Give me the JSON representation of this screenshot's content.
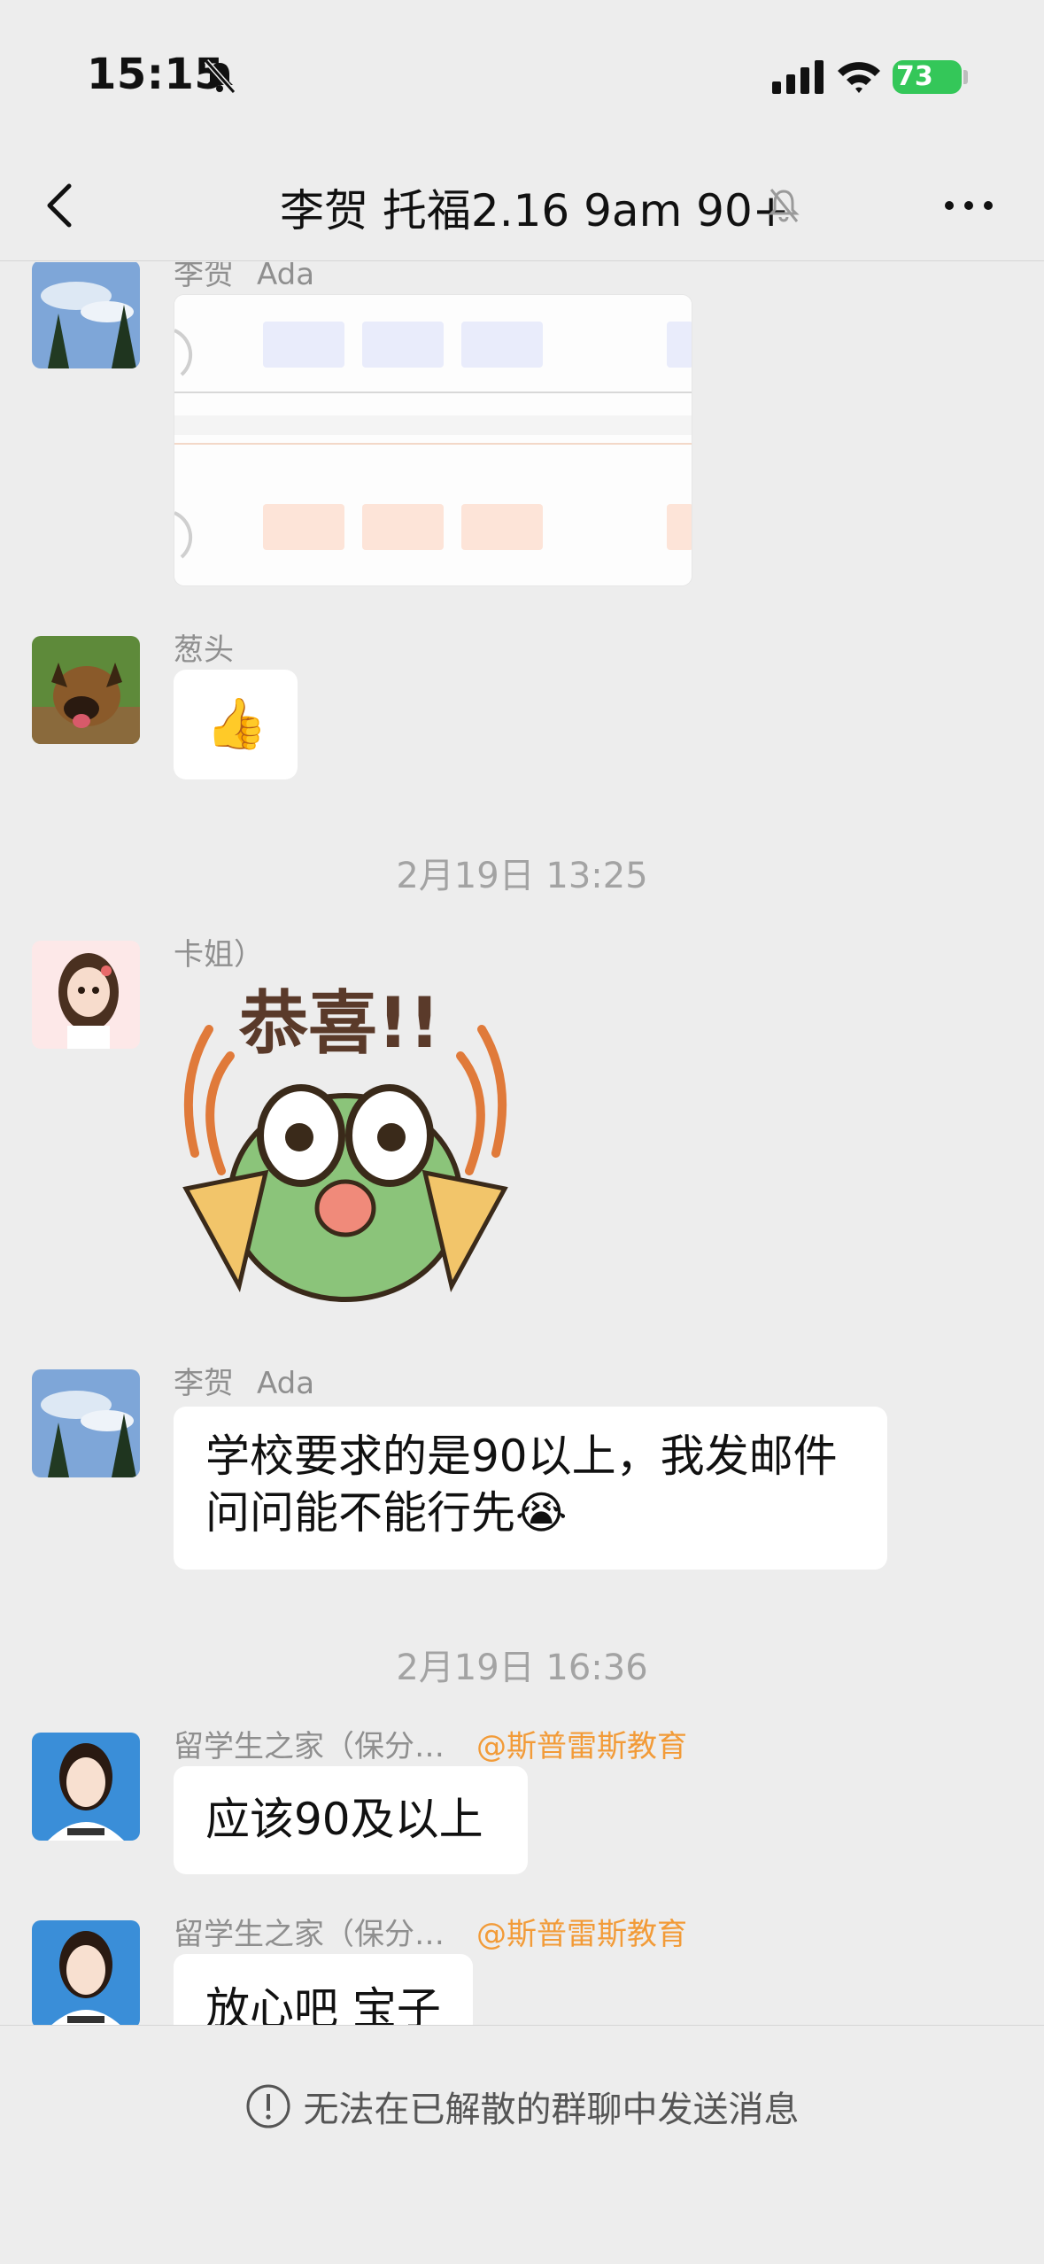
{
  "status_bar": {
    "time": "15:15",
    "battery_level": "73"
  },
  "nav": {
    "title": "李贺 托福2.16 9am 90+"
  },
  "messages": [
    {
      "sender": "李贺",
      "alias": "Ada",
      "type": "image"
    },
    {
      "sender": "葱头",
      "type": "emoji",
      "text": "👍"
    },
    {
      "timestamp": "2月19日 13:25"
    },
    {
      "sender": "卡姐）",
      "type": "sticker",
      "sticker_text": "恭喜!!"
    },
    {
      "sender": "李贺",
      "alias": "Ada",
      "type": "text",
      "lines": [
        "学校要求的是90以上，我发邮件",
        "问问能不能行先😭"
      ]
    },
    {
      "timestamp": "2月19日 16:36"
    },
    {
      "sender": "留学生之家（保分…",
      "mention": "@斯普雷斯教育",
      "type": "text",
      "text": "应该90及以上"
    },
    {
      "sender": "留学生之家（保分…",
      "mention": "@斯普雷斯教育",
      "type": "text",
      "text": "放心吧 宝子"
    }
  ],
  "footer": {
    "notice": "无法在已解散的群聊中发送消息"
  },
  "colors": {
    "background": "#ededed",
    "bubble": "#ffffff",
    "mention": "#f29b38",
    "battery": "#34c759"
  },
  "icons": [
    "bell-mute-icon",
    "signal-icon",
    "wifi-icon",
    "back-arrow-icon",
    "more-icon",
    "info-icon"
  ]
}
